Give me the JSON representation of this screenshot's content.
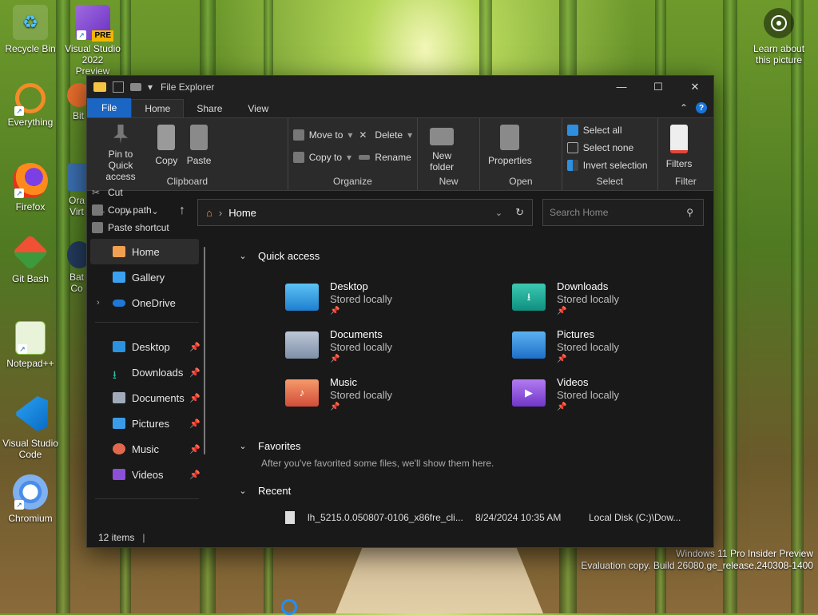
{
  "desktop": {
    "icons": [
      {
        "label": "Recycle Bin"
      },
      {
        "label": "Visual Studio 2022 Preview",
        "badge": "PRE"
      },
      {
        "label": "Everything"
      },
      {
        "label": "Bit"
      },
      {
        "label": "Firefox"
      },
      {
        "label": "Ora Virt"
      },
      {
        "label": "Git Bash"
      },
      {
        "label": "Bat Co"
      },
      {
        "label": "Notepad++"
      },
      {
        "label": "Visual Studio Code"
      },
      {
        "label": "Chromium"
      }
    ],
    "learn": "Learn about this picture",
    "watermark": {
      "line1": "Windows 11 Pro Insider Preview",
      "line2": "Evaluation copy. Build 26080.ge_release.240308-1400"
    }
  },
  "window": {
    "title": "File Explorer",
    "controls": {
      "minimize": "—",
      "maximize": "☐",
      "close": "✕"
    },
    "tabs": [
      "File",
      "Home",
      "Share",
      "View"
    ],
    "ribbon": {
      "clipboard": {
        "pin": "Pin to Quick access",
        "copy": "Copy",
        "paste": "Paste",
        "cut": "Cut",
        "copy_path": "Copy path",
        "paste_shortcut": "Paste shortcut",
        "name": "Clipboard"
      },
      "organize": {
        "move_to": "Move to",
        "copy_to": "Copy to",
        "delete": "Delete",
        "rename": "Rename",
        "name": "Organize"
      },
      "new": {
        "new_folder": "New folder",
        "name": "New"
      },
      "open": {
        "properties": "Properties",
        "name": "Open"
      },
      "select": {
        "select_all": "Select all",
        "select_none": "Select none",
        "invert": "Invert selection",
        "name": "Select"
      },
      "filter": {
        "filters": "Filters",
        "name": "Filter"
      }
    },
    "address": {
      "path": "Home"
    },
    "search": {
      "placeholder": "Search Home"
    },
    "sidebar": {
      "top": [
        {
          "label": "Home"
        },
        {
          "label": "Gallery"
        },
        {
          "label": "OneDrive"
        }
      ],
      "pinned": [
        {
          "label": "Desktop"
        },
        {
          "label": "Downloads"
        },
        {
          "label": "Documents"
        },
        {
          "label": "Pictures"
        },
        {
          "label": "Music"
        },
        {
          "label": "Videos"
        }
      ]
    },
    "quick_access": {
      "title": "Quick access",
      "items": [
        {
          "name": "Desktop",
          "status": "Stored locally",
          "color": "#1e90d8"
        },
        {
          "name": "Downloads",
          "status": "Stored locally",
          "color": "#13a89e"
        },
        {
          "name": "Documents",
          "status": "Stored locally",
          "color": "#8fa4bf"
        },
        {
          "name": "Pictures",
          "status": "Stored locally",
          "color": "#2e8fe0"
        },
        {
          "name": "Music",
          "status": "Stored locally",
          "color": "#e0694d"
        },
        {
          "name": "Videos",
          "status": "Stored locally",
          "color": "#8b4fd8"
        }
      ]
    },
    "favorites": {
      "title": "Favorites",
      "hint": "After you've favorited some files, we'll show them here."
    },
    "recent": {
      "title": "Recent",
      "items": [
        {
          "name": "lh_5215.0.050807-0106_x86fre_cli...",
          "date": "8/24/2024 10:35 AM",
          "location": "Local Disk (C:)\\Dow..."
        }
      ]
    },
    "status": {
      "count": "12 items"
    }
  },
  "colors": {
    "accent": "#1a66c2",
    "window_bg": "#191919",
    "ribbon_bg": "#2b2b2b"
  }
}
